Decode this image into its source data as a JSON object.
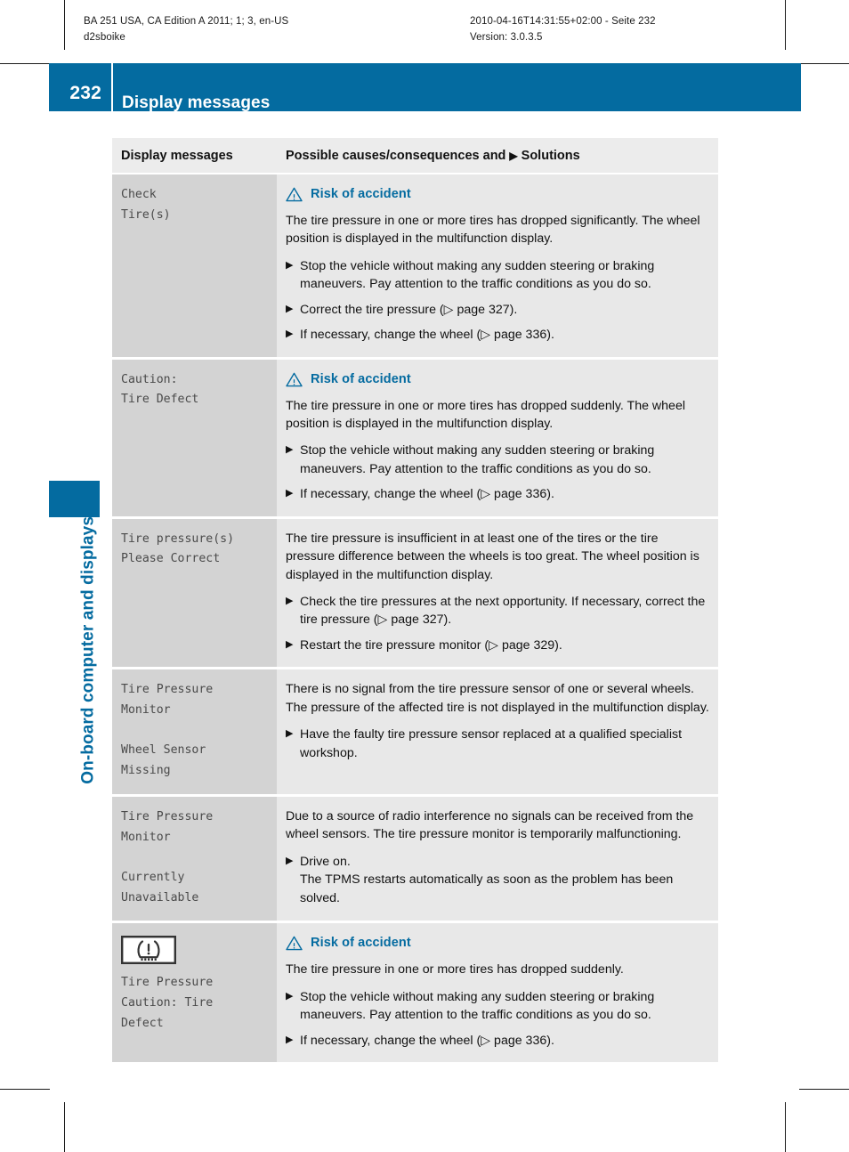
{
  "print_meta": {
    "left_line1": "BA 251 USA, CA Edition A 2011; 1; 3, en-US",
    "left_line2": "d2sboike",
    "right_line1": "2010-04-16T14:31:55+02:00 - Seite 232",
    "right_line2": "Version: 3.0.3.5"
  },
  "banner": {
    "page_number": "232",
    "title": "Display messages",
    "color": "#046ba0"
  },
  "chapter_rail": {
    "label": "On-board computer and displays",
    "color": "#046ba0"
  },
  "table": {
    "header": {
      "col1": "Display messages",
      "col2_before": "Possible causes/consequences and",
      "col2_marker": "▶",
      "col2_after": "Solutions"
    },
    "markers": {
      "step_bullet": "▶",
      "page_ref_open": "(▷ page ",
      "page_ref_close": ")."
    },
    "warning_label": "Risk of accident",
    "warning_color": "#046ba0",
    "rows": [
      {
        "message": "Check\nTire(s)",
        "has_warning": true,
        "has_icon": false,
        "paragraphs": [
          "The tire pressure in one or more tires has dropped significantly. The wheel position is displayed in the multifunction display."
        ],
        "steps": [
          {
            "text": "Stop the vehicle without making any sudden steering or braking maneuvers. Pay attention to the traffic conditions as you do so."
          },
          {
            "text": "Correct the tire pressure (▷ page 327)."
          },
          {
            "text": "If necessary, change the wheel (▷ page 336)."
          }
        ]
      },
      {
        "message": "Caution:\nTire Defect",
        "has_warning": true,
        "has_icon": false,
        "paragraphs": [
          "The tire pressure in one or more tires has dropped suddenly. The wheel position is displayed in the multifunction display."
        ],
        "steps": [
          {
            "text": "Stop the vehicle without making any sudden steering or braking maneuvers. Pay attention to the traffic conditions as you do so."
          },
          {
            "text": "If necessary, change the wheel (▷ page 336)."
          }
        ]
      },
      {
        "message": "Tire pressure(s)\nPlease Correct",
        "has_warning": false,
        "has_icon": false,
        "paragraphs": [
          "The tire pressure is insufficient in at least one of the tires or the tire pressure difference between the wheels is too great. The wheel position is displayed in the multifunction display."
        ],
        "steps": [
          {
            "text": "Check the tire pressures at the next opportunity. If necessary, correct the tire pressure (▷ page 327)."
          },
          {
            "text": "Restart the tire pressure monitor (▷ page 329)."
          }
        ]
      },
      {
        "message": "Tire Pressure\nMonitor\n\nWheel Sensor\nMissing",
        "has_warning": false,
        "has_icon": false,
        "paragraphs": [
          "There is no signal from the tire pressure sensor of one or several wheels. The pressure of the affected tire is not displayed in the multifunction display."
        ],
        "steps": [
          {
            "text": "Have the faulty tire pressure sensor replaced at a qualified specialist workshop."
          }
        ]
      },
      {
        "message": "Tire Pressure\nMonitor\n\nCurrently\nUnavailable",
        "has_warning": false,
        "has_icon": false,
        "paragraphs": [
          "Due to a source of radio interference no signals can be received from the wheel sensors. The tire pressure monitor is temporarily malfunctioning."
        ],
        "steps": [
          {
            "text": "Drive on.",
            "sub": "The TPMS restarts automatically as soon as the problem has been solved."
          }
        ]
      },
      {
        "message": "Tire Pressure\nCaution: Tire\nDefect",
        "has_warning": true,
        "has_icon": true,
        "icon_name": "tire-pressure-warning-telltale",
        "paragraphs": [
          "The tire pressure in one or more tires has dropped suddenly."
        ],
        "steps": [
          {
            "text": "Stop the vehicle without making any sudden steering or braking maneuvers. Pay attention to the traffic conditions as you do so."
          },
          {
            "text": "If necessary, change the wheel (▷ page 336)."
          }
        ]
      }
    ]
  }
}
